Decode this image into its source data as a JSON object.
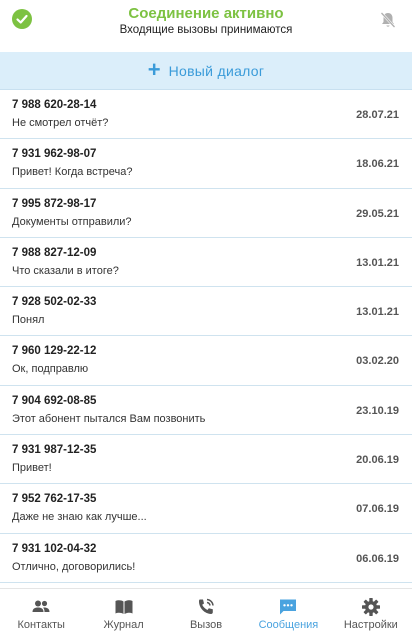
{
  "status": {
    "title": "Соединение активно",
    "subtitle": "Входящие вызовы принимаются",
    "accent": "#7dc242"
  },
  "new_dialog": {
    "label": "Новый диалог",
    "icon": "plus-icon",
    "color": "#3a9bd9"
  },
  "conversations": [
    {
      "phone": "7 988 620-28-14",
      "message": "Не смотрел отчёт?",
      "date": "28.07.21"
    },
    {
      "phone": "7 931 962-98-07",
      "message": "Привет! Когда встреча?",
      "date": "18.06.21"
    },
    {
      "phone": "7 995 872-98-17",
      "message": "Документы отправили?",
      "date": "29.05.21"
    },
    {
      "phone": "7 988 827-12-09",
      "message": "Что сказали в итоге?",
      "date": "13.01.21"
    },
    {
      "phone": "7 928 502-02-33",
      "message": "Понял",
      "date": "13.01.21"
    },
    {
      "phone": "7 960 129-22-12",
      "message": "Ок, подправлю",
      "date": "03.02.20"
    },
    {
      "phone": "7 904 692-08-85",
      "message": "Этот абонент пытался Вам позвонить",
      "date": "23.10.19"
    },
    {
      "phone": "7 931 987-12-35",
      "message": "Привет!",
      "date": "20.06.19"
    },
    {
      "phone": "7 952 762-17-35",
      "message": "Даже не знаю как лучше...",
      "date": "07.06.19"
    },
    {
      "phone": "7 931 102-04-32",
      "message": "Отлично, договорились!",
      "date": "06.06.19"
    }
  ],
  "nav": {
    "contacts": "Контакты",
    "journal": "Журнал",
    "call": "Вызов",
    "messages": "Сообщения",
    "settings": "Настройки",
    "active": "messages",
    "active_color": "#4aa3df"
  }
}
